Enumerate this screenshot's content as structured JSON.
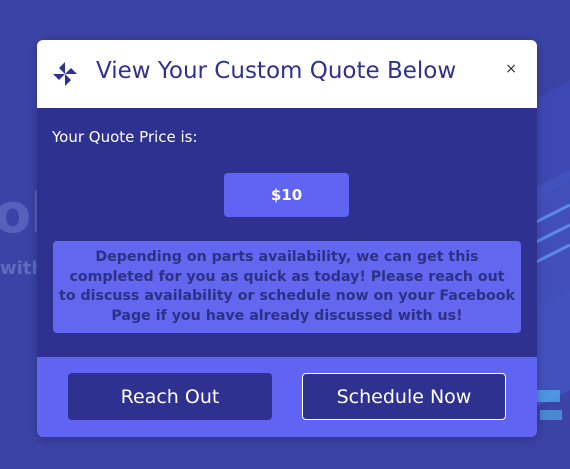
{
  "background": {
    "headline_fragment": "ol",
    "subline_fragment": "with"
  },
  "modal": {
    "title": "View Your Custom Quote Below",
    "close_label": "×",
    "logo_icon": "pinwheel-icon",
    "price_label": "Your Quote Price is:",
    "price_value": "$10",
    "notice": "Depending on parts availability, we can get this completed for you as quick as today! Please reach out to discuss availability or schedule now on your Facebook Page if you have already discussed with us!",
    "buttons": {
      "reach_out": "Reach Out",
      "schedule_now": "Schedule Now"
    }
  },
  "colors": {
    "page_bg": "#3b43a6",
    "modal_body": "#2e3190",
    "accent": "#5f65f2",
    "header_bg": "#ffffff"
  }
}
